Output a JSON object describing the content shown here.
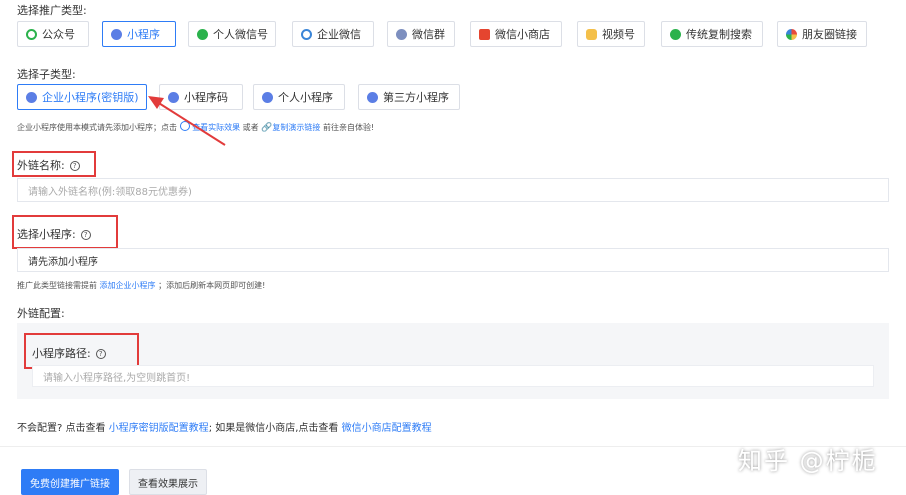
{
  "promo_type": {
    "label": "选择推广类型:",
    "options": [
      {
        "label": "公众号"
      },
      {
        "label": "小程序"
      },
      {
        "label": "个人微信号"
      },
      {
        "label": "企业微信"
      },
      {
        "label": "微信群"
      },
      {
        "label": "微信小商店"
      },
      {
        "label": "视频号"
      },
      {
        "label": "传统复制搜索"
      },
      {
        "label": "朋友圈链接"
      }
    ],
    "selected": "小程序"
  },
  "sub_type": {
    "label": "选择子类型:",
    "options": [
      {
        "label": "企业小程序(密钥版)"
      },
      {
        "label": "小程序码"
      },
      {
        "label": "个人小程序"
      },
      {
        "label": "第三方小程序"
      }
    ],
    "selected": "企业小程序(密钥版)",
    "hint_prefix": "企业小程序使用本模式请先添加小程序；点击",
    "hint_link1": "查看实际效果",
    "hint_mid": "或者",
    "hint_link2": "复制演示链接",
    "hint_suffix": "前往亲自体验!"
  },
  "link_name": {
    "label": "外链名称:",
    "help": "?",
    "placeholder": "请输入外链名称(例:领取88元优惠券)"
  },
  "mini_program": {
    "label": "选择小程序:",
    "help": "?",
    "value": "请先添加小程序",
    "hint_prefix": "推广此类型链接需提前",
    "hint_link": "添加企业小程序",
    "hint_suffix": "；添加后刷新本网页即可创建!"
  },
  "link_config": {
    "label": "外链配置:",
    "path_label": "小程序路径:",
    "help": "?",
    "path_placeholder": "请输入小程序路径,为空则跳首页!"
  },
  "tutorial": {
    "prefix": "不会配置? 点击查看",
    "link1": "小程序密钥版配置教程",
    "mid": "; 如果是微信小商店,点击查看",
    "link2": "微信小商店配置教程"
  },
  "actions": {
    "create": "免费创建推广链接",
    "preview": "查看效果展示"
  },
  "watermark": "知乎 @柠栀",
  "colors": {
    "primary": "#2e7cf6",
    "annotation_red": "#e23b3b"
  }
}
